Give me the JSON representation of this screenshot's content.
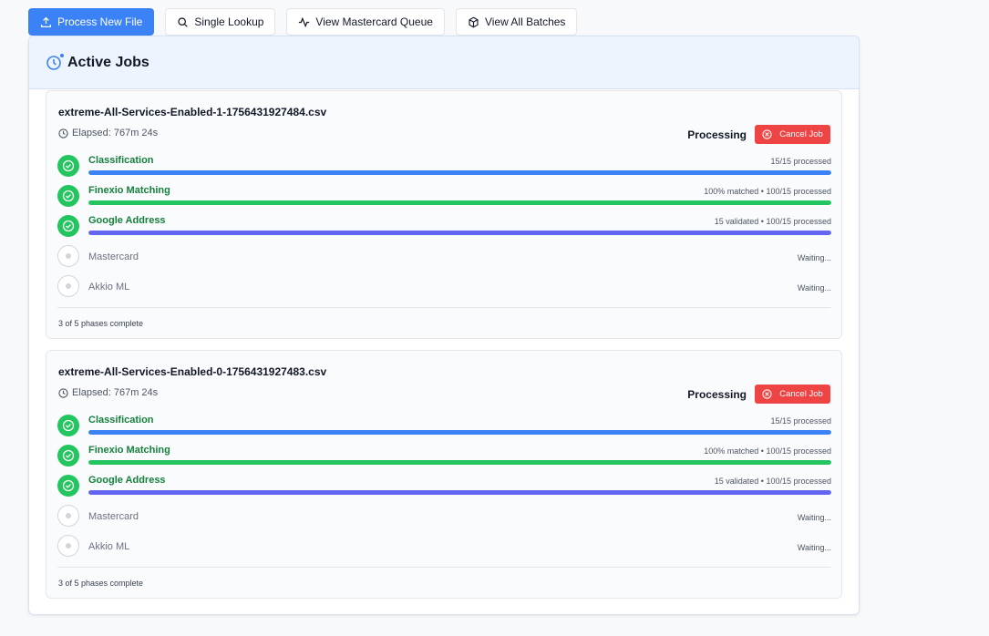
{
  "toolbar": {
    "process_label": "Process New File",
    "lookup_label": "Single Lookup",
    "queue_label": "View Mastercard Queue",
    "batches_label": "View All Batches"
  },
  "panel": {
    "title": "Active Jobs"
  },
  "colors": {
    "primary": "#3b82f6",
    "success": "#22c55e",
    "danger": "#ef4444",
    "classification_bar": "#3b82f6",
    "finexio_bar": "#22c55e",
    "google_bar": "#6366f1"
  },
  "jobs": [
    {
      "name": "extreme-All-Services-Enabled-1-1756431927484.csv",
      "elapsed": "Elapsed: 767m 24s",
      "status": "Processing",
      "cancel_label": "Cancel Job",
      "phases": [
        {
          "name": "Classification",
          "info": "15/15 processed",
          "state": "done",
          "progress": 1.0
        },
        {
          "name": "Finexio Matching",
          "info": "100% matched • 100/15 processed",
          "state": "done",
          "progress": 1.0
        },
        {
          "name": "Google Address",
          "info": "15 validated • 100/15 processed",
          "state": "done",
          "progress": 1.0
        },
        {
          "name": "Mastercard",
          "info": "Waiting...",
          "state": "waiting"
        },
        {
          "name": "Akkio ML",
          "info": "Waiting...",
          "state": "waiting"
        }
      ],
      "summary": "3 of 5 phases complete"
    },
    {
      "name": "extreme-All-Services-Enabled-0-1756431927483.csv",
      "elapsed": "Elapsed: 767m 24s",
      "status": "Processing",
      "cancel_label": "Cancel Job",
      "phases": [
        {
          "name": "Classification",
          "info": "15/15 processed",
          "state": "done",
          "progress": 1.0
        },
        {
          "name": "Finexio Matching",
          "info": "100% matched • 100/15 processed",
          "state": "done",
          "progress": 1.0
        },
        {
          "name": "Google Address",
          "info": "15 validated • 100/15 processed",
          "state": "done",
          "progress": 1.0
        },
        {
          "name": "Mastercard",
          "info": "Waiting...",
          "state": "waiting"
        },
        {
          "name": "Akkio ML",
          "info": "Waiting...",
          "state": "waiting"
        }
      ],
      "summary": "3 of 5 phases complete"
    }
  ]
}
